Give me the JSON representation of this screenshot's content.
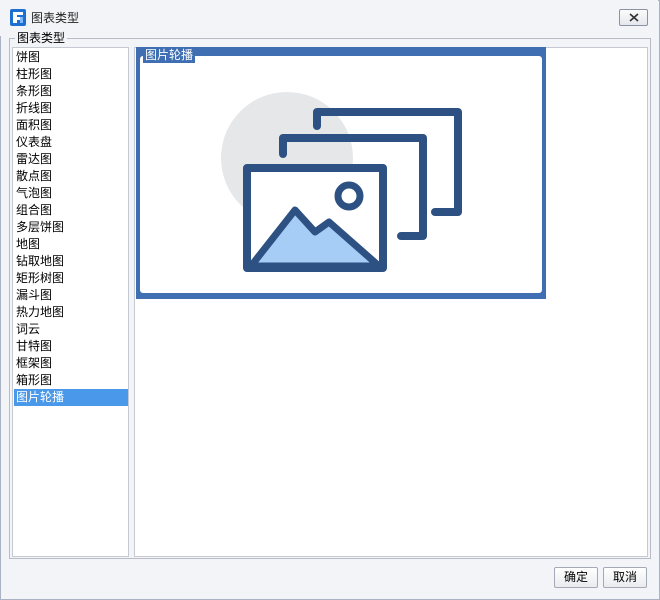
{
  "window": {
    "title": "图表类型"
  },
  "group": {
    "label": "图表类型"
  },
  "chart_types": [
    "饼图",
    "柱形图",
    "条形图",
    "折线图",
    "面积图",
    "仪表盘",
    "雷达图",
    "散点图",
    "气泡图",
    "组合图",
    "多层饼图",
    "地图",
    "钻取地图",
    "矩形树图",
    "漏斗图",
    "热力地图",
    "词云",
    "甘特图",
    "框架图",
    "箱形图",
    "图片轮播"
  ],
  "selected_index": 20,
  "preview": {
    "card_label": "图片轮播",
    "icon": "image-carousel-icon"
  },
  "buttons": {
    "ok": "确定",
    "cancel": "取消"
  },
  "colors": {
    "accent": "#3f6fb2",
    "selection": "#4a98ea",
    "icon_dark": "#2e5183",
    "icon_light": "#a5cdf5",
    "icon_circle": "#e6e7e9"
  }
}
